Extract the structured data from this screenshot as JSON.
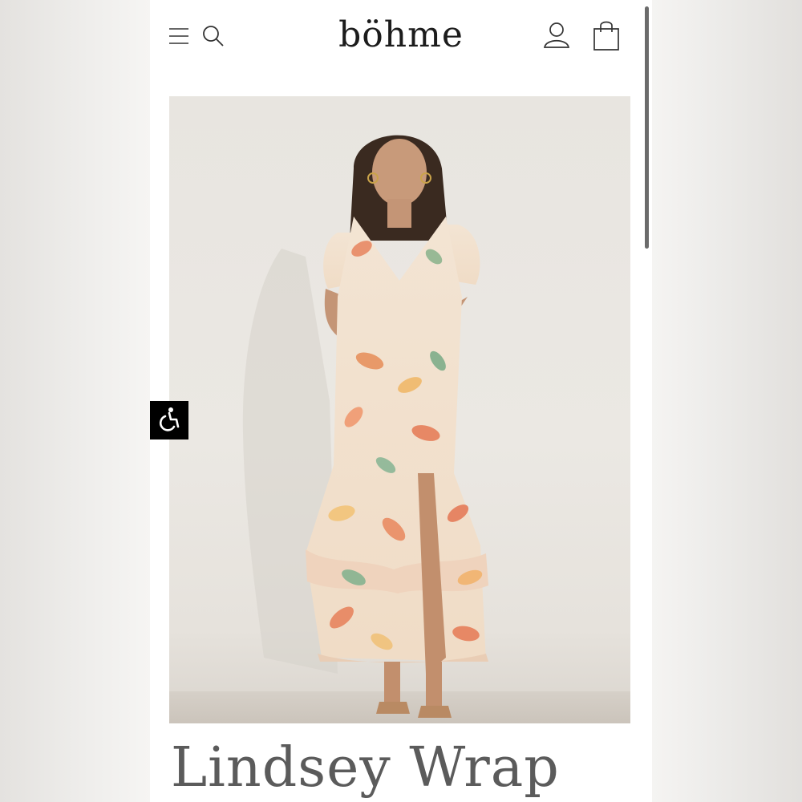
{
  "header": {
    "brand_name": "böhme",
    "icons": [
      "menu-icon",
      "search-icon",
      "account-icon",
      "shopping-bag-icon"
    ]
  },
  "hero": {
    "image": "model-in-floral-wrap-dress"
  },
  "accessibility_button": {
    "icon": "accessibility-icon"
  },
  "product": {
    "title": "Lindsey Wrap"
  },
  "colors": {
    "page_background": "#ffffff",
    "text_dark": "#1c1c1c",
    "title_gray": "#5b5b5b",
    "accessibility_bg": "#000000"
  }
}
